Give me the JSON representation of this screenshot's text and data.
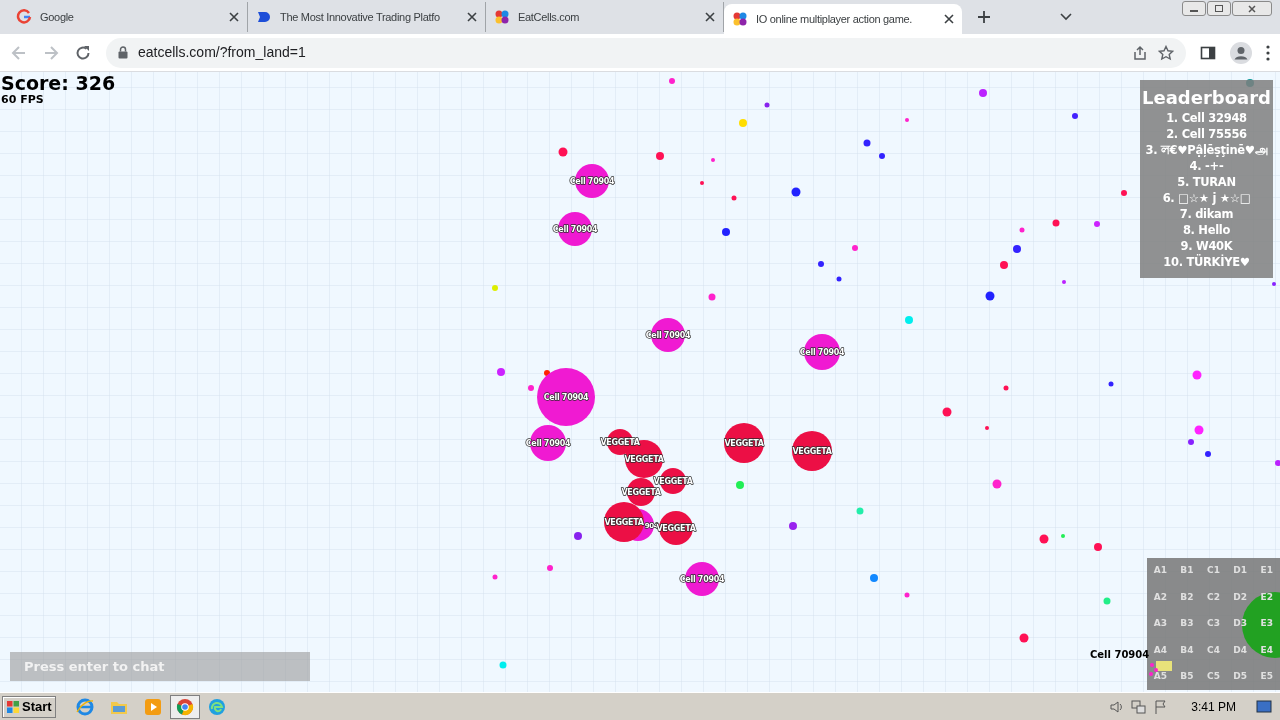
{
  "browser": {
    "tabs": [
      {
        "title": "Google",
        "kind": "google",
        "selected": false
      },
      {
        "title": "The Most Innovative Trading Platfo",
        "kind": "trading",
        "selected": false
      },
      {
        "title": "EatCells.com",
        "kind": "eatcells",
        "selected": false
      },
      {
        "title": "IO online multiplayer action game.",
        "kind": "eatcells",
        "selected": true
      }
    ],
    "address": "eatcells.com/?from_land=1"
  },
  "game": {
    "score": "Score: 326",
    "fps": "60 FPS",
    "leaderboard": {
      "title": "Leaderboard",
      "entries": [
        "1. Cell 32948",
        "2. Cell 75556",
        "3. ল€♥Pậļēṣţinē♥அ",
        "4. -+-",
        "5. TURAN",
        "6. □☆★ j ★☆□",
        "7. dikam",
        "8. Hello",
        "9. W40K",
        "10. TÜRKİYE♥"
      ]
    },
    "cells": [
      {
        "label": "Cell 70904",
        "color": "#f01ad2"
      },
      {
        "label": "Cell 70904",
        "color": "#f01ad2"
      },
      {
        "label": "Cell 70904",
        "color": "#f01ad2"
      },
      {
        "label": "Cell 70904",
        "color": "#f01ad2"
      },
      {
        "label": "Cell 70904",
        "color": "#f01ad2"
      },
      {
        "label": "Cell 70904",
        "color": "#f01ad2"
      },
      {
        "label": "904",
        "color": "#f01ad2"
      },
      {
        "label": "Cell 70904",
        "color": "#f01ad2"
      },
      {
        "label": "VEGGETA",
        "color": "#ec0f45"
      },
      {
        "label": "VEGGETA",
        "color": "#ec0f45"
      },
      {
        "label": "VEGGETA",
        "color": "#ec0f45"
      },
      {
        "label": "VEGGETA",
        "color": "#ec0f45"
      },
      {
        "label": "VEGGETA",
        "color": "#ec0f45"
      },
      {
        "label": "VEGGETA",
        "color": "#ec0f45"
      },
      {
        "label": "VEGGETA",
        "color": "#ec0f45"
      },
      {
        "label": "VEGGETA",
        "color": "#ec0f45"
      }
    ],
    "chat": {
      "placeholder": "Press enter to chat"
    },
    "minimap": {
      "rows": [
        [
          "A1",
          "B1",
          "C1",
          "D1",
          "E1"
        ],
        [
          "A2",
          "B2",
          "C2",
          "D2",
          "E2"
        ],
        [
          "A3",
          "B3",
          "C3",
          "D3",
          "E3"
        ],
        [
          "A4",
          "B4",
          "C4",
          "D4",
          "E4"
        ],
        [
          "A5",
          "B5",
          "C5",
          "D5",
          "E5"
        ]
      ],
      "player_label": "Cell 70904"
    }
  },
  "taskbar": {
    "start": "Start",
    "clock": "3:41 PM"
  }
}
